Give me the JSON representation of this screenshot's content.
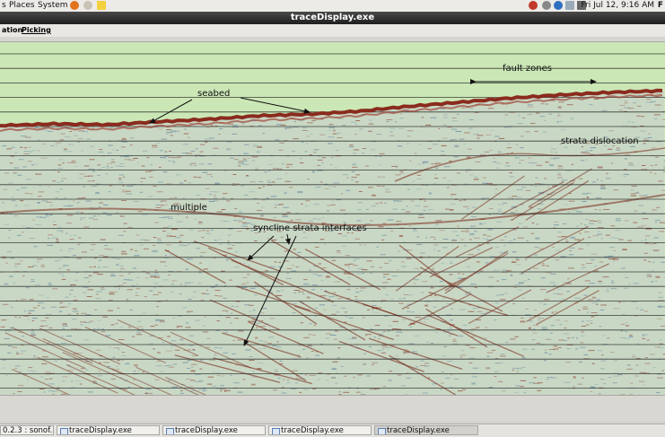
{
  "top_panel": {
    "menus": [
      "s",
      "Places",
      "System"
    ],
    "datetime": "Fri Jul 12,  9:16 AM",
    "right_letter": "F"
  },
  "window": {
    "title": "traceDisplay.exe"
  },
  "menubar": {
    "items": [
      "ation",
      "Picking"
    ]
  },
  "annotations": {
    "seabed": "seabed",
    "fault_zones": "fault zones",
    "strata_dislocation": "strata dislocation",
    "multiple": "multiple",
    "syncline": "syncline strata interfaces"
  },
  "taskbar": {
    "items": [
      {
        "label": "0.2.3 : sonof..."
      },
      {
        "label": "traceDisplay.exe"
      },
      {
        "label": "traceDisplay.exe"
      },
      {
        "label": "traceDisplay.exe"
      },
      {
        "label": "traceDisplay.exe",
        "active": true
      }
    ]
  },
  "colors": {
    "water": "#cbe7b6",
    "seabed": "#8a2b1e",
    "noise": "#c9d8c5"
  },
  "icons": [
    "firefox-icon",
    "email-icon",
    "notes-icon",
    "help-icon",
    "volume-icon",
    "bluetooth-icon",
    "mail-icon",
    "network-icon"
  ]
}
